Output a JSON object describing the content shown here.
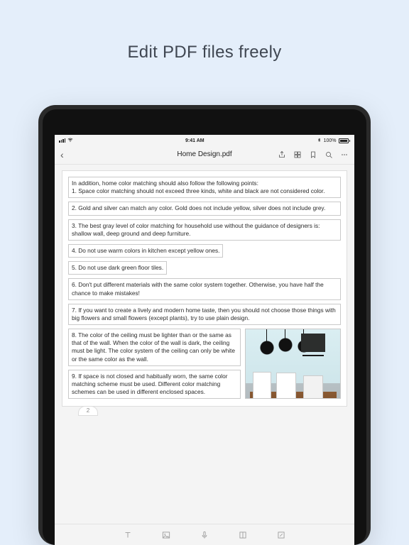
{
  "promo": {
    "title": "Edit PDF files freely"
  },
  "status": {
    "time": "9:41 AM",
    "battery_text": "100%",
    "bt_icon": "bluetooth-icon",
    "wifi_icon": "wifi-icon"
  },
  "header": {
    "title": "Home Design.pdf",
    "back": "‹",
    "actions": {
      "share": "share-icon",
      "grid": "grid-icon",
      "bookmark": "bookmark-icon",
      "search": "search-icon",
      "more": "more-icon"
    }
  },
  "document": {
    "page_number": "2",
    "paragraphs": [
      "In addition, home color matching should also follow the following points:\n1. Space color matching should not exceed three kinds, white and black are not considered color.",
      "2. Gold and silver can match any color. Gold does not include yellow, silver does not include grey.",
      "3. The best gray level of color matching for household use without the guidance of designers is: shallow wall, deep ground and deep furniture.",
      "4. Do not use warm colors in kitchen except yellow ones.",
      "5. Do not use dark green floor tiles.",
      "6. Don't put different materials with the same color system together. Otherwise, you have half the chance to make mistakes!",
      "7. If you want to create a lively and modern home taste, then you should not choose those things with big flowers and small flowers (except plants), try to use plain design.",
      "8. The color of the ceiling must be lighter than or the same as that of the wall. When the color of the wall is dark, the ceiling must be light. The color system of the ceiling can only be white or the same color as the wall.",
      "9. If space is not closed and habitually worn, the same color matching scheme must be used. Different color matching schemes can be used in different enclosed spaces."
    ]
  },
  "toolbar": {
    "tools": [
      "text-tool",
      "image-tool",
      "voice-tool",
      "layout-tool",
      "annotate-tool"
    ]
  }
}
